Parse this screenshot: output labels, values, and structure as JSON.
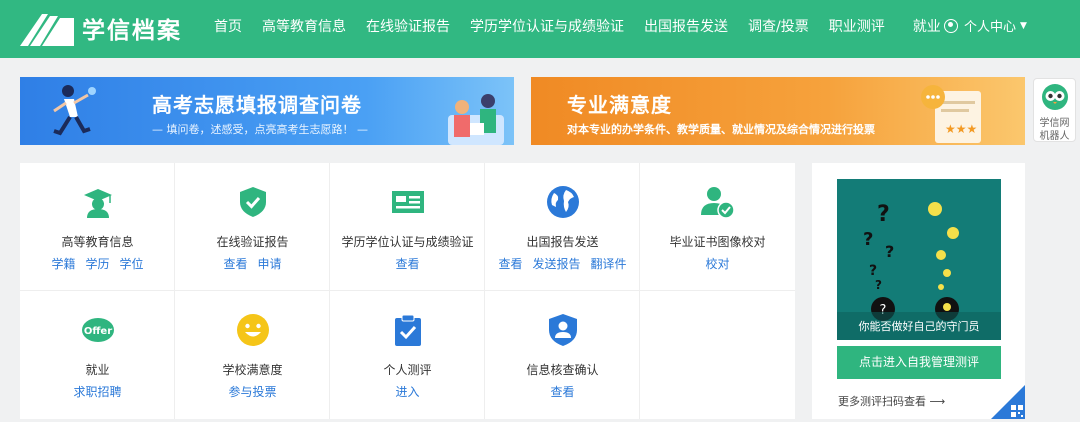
{
  "header": {
    "logo_text": "学信档案",
    "nav": [
      "首页",
      "高等教育信息",
      "在线验证报告",
      "学历学位认证与成绩验证",
      "出国报告发送",
      "调查/投票",
      "职业测评",
      "就业"
    ],
    "user_menu": "个人中心",
    "accent_color": "#31b882"
  },
  "banners": {
    "survey": {
      "title": "高考志愿填报调查问卷",
      "subtitle": "— 填问卷，述感受，点亮高考生志愿路！ —"
    },
    "satisfaction": {
      "title": "专业满意度",
      "subtitle": "对本专业的办学条件、教学质量、就业情况及综合情况进行投票"
    }
  },
  "robot": {
    "line1": "学信网",
    "line2": "机器人"
  },
  "services": [
    {
      "icon": "graduation-cap-icon",
      "title": "高等教育信息",
      "links": [
        "学籍",
        "学历",
        "学位"
      ]
    },
    {
      "icon": "shield-check-icon",
      "title": "在线验证报告",
      "links": [
        "查看",
        "申请"
      ]
    },
    {
      "icon": "id-card-icon",
      "title": "学历学位认证与成绩验证",
      "links": [
        "查看"
      ]
    },
    {
      "icon": "globe-icon",
      "title": "出国报告发送",
      "links": [
        "查看",
        "发送报告",
        "翻译件"
      ]
    },
    {
      "icon": "user-check-icon",
      "title": "毕业证书图像校对",
      "links": [
        "校对"
      ]
    },
    {
      "icon": "offer-icon",
      "icon_text": "Offer",
      "title": "就业",
      "links": [
        "求职招聘"
      ]
    },
    {
      "icon": "smiley-icon",
      "title": "学校满意度",
      "links": [
        "参与投票"
      ]
    },
    {
      "icon": "clipboard-check-icon",
      "title": "个人测评",
      "links": [
        "进入"
      ]
    },
    {
      "icon": "user-shield-icon",
      "title": "信息核查确认",
      "links": [
        "查看"
      ]
    }
  ],
  "side_panel": {
    "image_caption": "你能否做好自己的守门员",
    "button": "点击进入自我管理测评",
    "more": "更多测评扫码查看 ⟶"
  }
}
